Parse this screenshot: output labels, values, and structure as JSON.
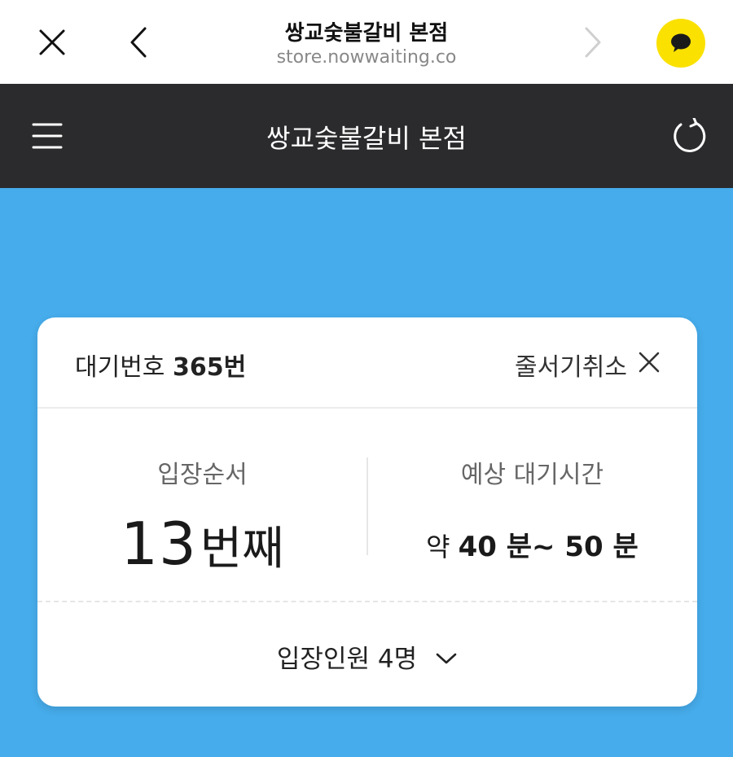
{
  "browser": {
    "title": "쌍교숯불갈비 본점",
    "url": "store.nowwaiting.co"
  },
  "header": {
    "title": "쌍교숯불갈비 본점"
  },
  "card": {
    "wait_number_label": "대기번호",
    "wait_number_value": "365번",
    "cancel_label": "줄서기취소",
    "order_label": "입장순서",
    "order_number": "13",
    "order_unit": "번째",
    "time_label": "예상 대기시간",
    "time_prefix": "약",
    "time_value": "40 분~ 50 분",
    "people_label": "입장인원 4명"
  },
  "colors": {
    "background": "#46aceb",
    "header": "#2b2b2d",
    "kakao_yellow": "#fae100"
  }
}
